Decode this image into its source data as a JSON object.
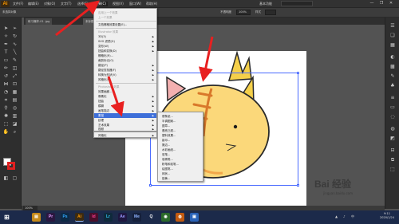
{
  "app": {
    "logo": "Ai",
    "accent": "#ff9a00"
  },
  "menubar": {
    "items": [
      "文件(F)",
      "编辑(E)",
      "对象(O)",
      "文字(T)",
      "选择(S)",
      "效果(C)",
      "视图(V)",
      "窗口(W)",
      "帮助(H)"
    ],
    "active_index": 5,
    "workspace": "基本功能",
    "window_controls": [
      "—",
      "❐",
      "✕"
    ]
  },
  "controlbar": {
    "left_label": "未选择对象",
    "opacity_label": "不透明度",
    "opacity_value": "100%",
    "style_label": "样式"
  },
  "document_tabs": [
    "练习爆炸-01 .jpg",
    "未标题-1* @ 100% (RGB/预览)"
  ],
  "effect_menu": {
    "items": [
      {
        "label": "应用上一个效果",
        "shortcut": "Shift+Ctrl+E",
        "disabled": true
      },
      {
        "label": "上一个效果",
        "shortcut": "Alt+Shift+Ctrl+E",
        "disabled": true
      },
      {
        "label": "文档栅格效果设置(E)...",
        "disabled": false
      },
      {
        "label": "Illustrator 效果",
        "disabled": true,
        "header": true
      },
      {
        "label": "3D(3)",
        "submenu": true
      },
      {
        "label": "SVG 滤镜(G)",
        "submenu": true
      },
      {
        "label": "变形(W)",
        "submenu": true
      },
      {
        "label": "扭曲和变换(D)",
        "submenu": true
      },
      {
        "label": "栅格化(R)...",
        "disabled": false
      },
      {
        "label": "裁剪标记(O)",
        "disabled": false
      },
      {
        "label": "路径(P)",
        "submenu": true
      },
      {
        "label": "路径查找器(F)",
        "submenu": true
      },
      {
        "label": "转换为形状(V)",
        "submenu": true
      },
      {
        "label": "风格化(S)",
        "submenu": true
      },
      {
        "label": "Photoshop 效果",
        "disabled": true,
        "header": true
      },
      {
        "label": "效果画廊...",
        "disabled": false
      },
      {
        "label": "像素化",
        "submenu": true
      },
      {
        "label": "扭曲",
        "submenu": true
      },
      {
        "label": "模糊",
        "submenu": true
      },
      {
        "label": "画笔描边",
        "submenu": true
      },
      {
        "label": "素描",
        "submenu": true,
        "highlighted": true
      },
      {
        "label": "纹理",
        "submenu": true
      },
      {
        "label": "艺术效果",
        "submenu": true
      },
      {
        "label": "视频",
        "submenu": true
      },
      {
        "label": "风格化",
        "submenu": true
      }
    ]
  },
  "sketch_submenu": {
    "items": [
      "便条纸...",
      "半调图案...",
      "图章...",
      "基底凸现...",
      "塑料效果...",
      "影印...",
      "撕边...",
      "水彩画纸...",
      "炭笔...",
      "炭精笔...",
      "粉笔和炭笔...",
      "绘图笔...",
      "网状...",
      "铬黄..."
    ]
  },
  "statusbar": {
    "zoom": "100%"
  },
  "taskbar": {
    "apps": [
      {
        "name": "windows-start",
        "glyph": "⊞",
        "color": "#1c2a4a"
      },
      {
        "name": "file-explorer",
        "glyph": "▤",
        "color": "#c58a1a"
      },
      {
        "name": "premiere",
        "glyph": "Pr",
        "color": "#2a1740"
      },
      {
        "name": "photoshop",
        "glyph": "Ps",
        "color": "#0d2a45"
      },
      {
        "name": "illustrator",
        "glyph": "Ai",
        "color": "#3b2a12",
        "active": true
      },
      {
        "name": "indesign",
        "glyph": "Id",
        "color": "#4a0f2a"
      },
      {
        "name": "lightroom",
        "glyph": "Lr",
        "color": "#0f2a3b"
      },
      {
        "name": "after-effects",
        "glyph": "Ae",
        "color": "#1f1740"
      },
      {
        "name": "media-encoder",
        "glyph": "Me",
        "color": "#15203b"
      },
      {
        "name": "qq",
        "glyph": "Q",
        "color": "#1c2a4a"
      },
      {
        "name": "chrome",
        "glyph": "◉",
        "color": "#2b6a2b"
      },
      {
        "name": "firefox",
        "glyph": "◍",
        "color": "#c25a10"
      },
      {
        "name": "app-blue",
        "glyph": "▣",
        "color": "#2a63b8"
      }
    ],
    "clock_time": "9:11",
    "clock_date": "2020/1/24"
  },
  "watermark": {
    "brand": "Bai 经验",
    "url": "jingyan.baidu.com"
  }
}
